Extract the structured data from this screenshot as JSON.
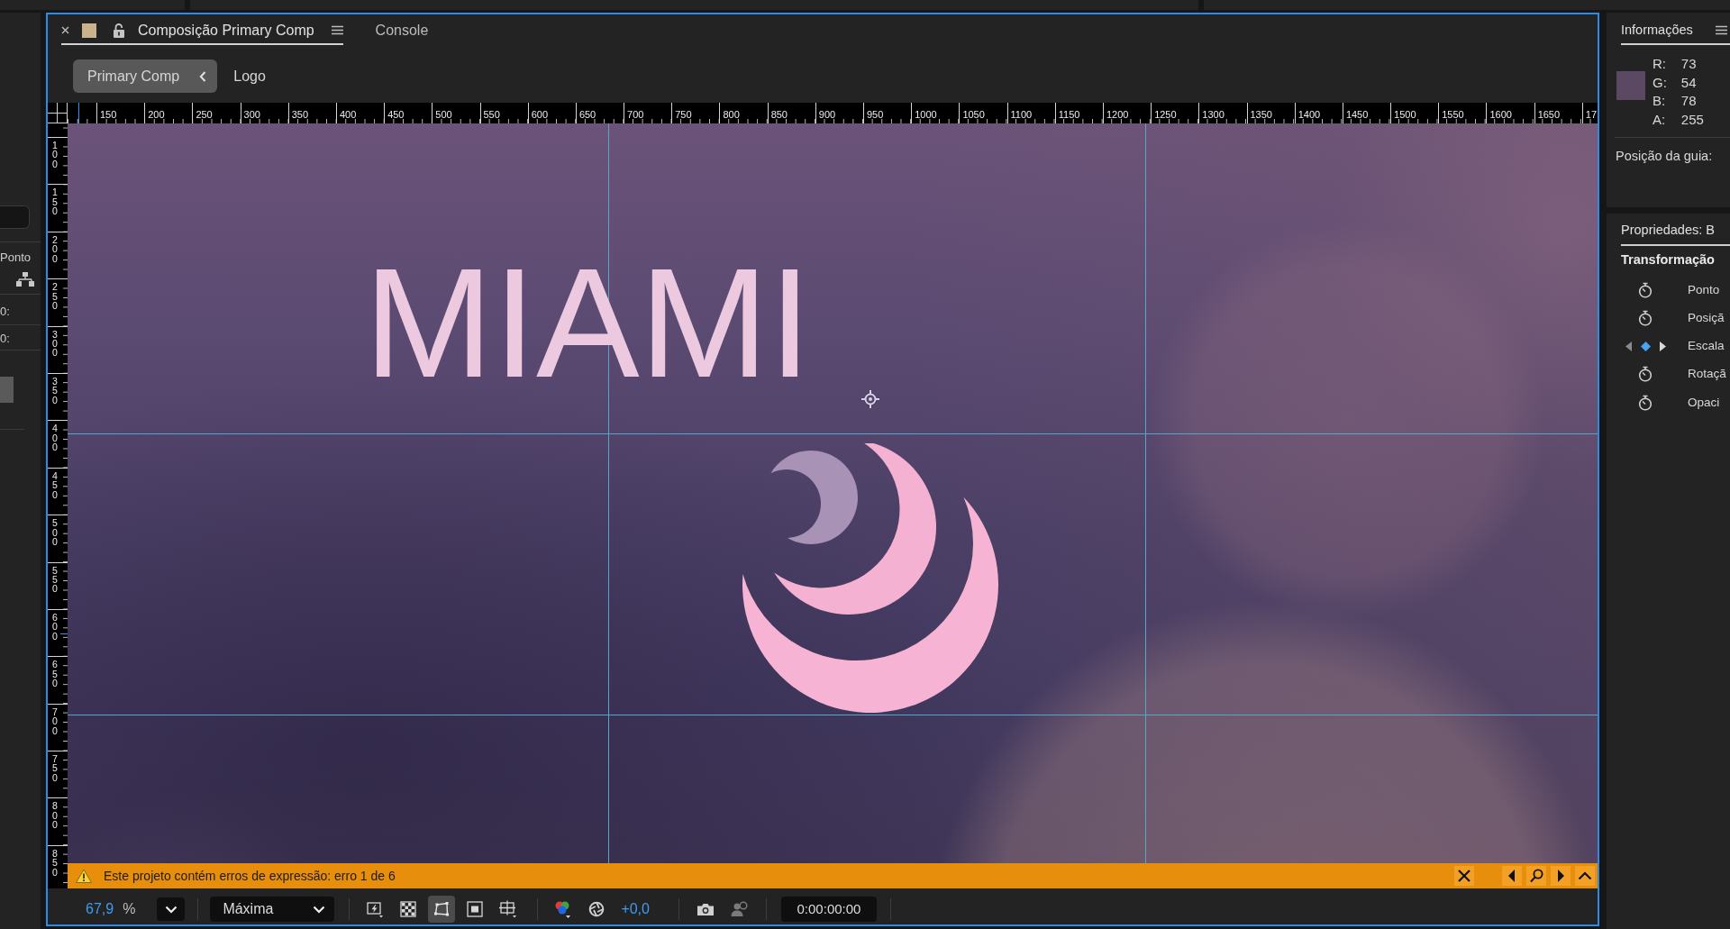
{
  "left_panel": {
    "heading": "Ponto",
    "values": [
      "0:",
      "0:"
    ]
  },
  "composition_panel": {
    "tabs": [
      {
        "kind": "composition",
        "label": "Composição Primary Comp",
        "selected": true
      },
      {
        "kind": "panel",
        "label": "Console",
        "selected": false
      }
    ],
    "breadcrumbs": [
      {
        "label": "Primary Comp",
        "selected": true
      },
      {
        "label": "Logo",
        "selected": false
      }
    ],
    "ruler_top": {
      "labels": [
        "150",
        "200",
        "250",
        "300",
        "350",
        "400",
        "450",
        "500",
        "550",
        "600",
        "650",
        "700",
        "750",
        "800",
        "850",
        "900",
        "950",
        "1000",
        "1050",
        "1100",
        "1150",
        "1200",
        "1250",
        "1300",
        "1350",
        "1400",
        "1450",
        "1500",
        "1550",
        "1600",
        "1650",
        "17"
      ]
    },
    "ruler_left": {
      "labels": [
        "100",
        "150",
        "200",
        "250",
        "300",
        "350",
        "400",
        "450",
        "500",
        "550",
        "600",
        "650",
        "700",
        "750",
        "800",
        "850"
      ]
    },
    "canvas": {
      "title": "MIAMI"
    },
    "warning": {
      "message": "Este projeto contém erros de expressão: erro 1 de 6"
    },
    "toolbar": {
      "zoom": "67,9",
      "zoom_unit": "%",
      "resolution": "Máxima",
      "view_toggles": [
        {
          "kind": "fast-previews",
          "on": false
        },
        {
          "kind": "transparency-grid",
          "on": false
        },
        {
          "kind": "mask-visibility",
          "on": true
        },
        {
          "kind": "region-of-interest",
          "on": false
        },
        {
          "kind": "guides-grid",
          "on": false
        }
      ],
      "exposure": "+0,0",
      "timecode": "0:00:00:00"
    }
  },
  "info_panel": {
    "title": "Informações",
    "channels": [
      {
        "label": "R:",
        "value": "73"
      },
      {
        "label": "G:",
        "value": "54"
      },
      {
        "label": "B:",
        "value": "78"
      },
      {
        "label": "A:",
        "value": "255"
      }
    ],
    "guide_position": "Posição da guia:"
  },
  "properties_panel": {
    "title": "Propriedades: B",
    "group": "Transformação",
    "properties": [
      {
        "label": "Ponto",
        "keyframed": false
      },
      {
        "label": "Posiçã",
        "keyframed": false
      },
      {
        "label": "Escala",
        "keyframed": true
      },
      {
        "label": "Rotaçã",
        "keyframed": false
      },
      {
        "label": "Opaci",
        "keyframed": false
      }
    ]
  }
}
